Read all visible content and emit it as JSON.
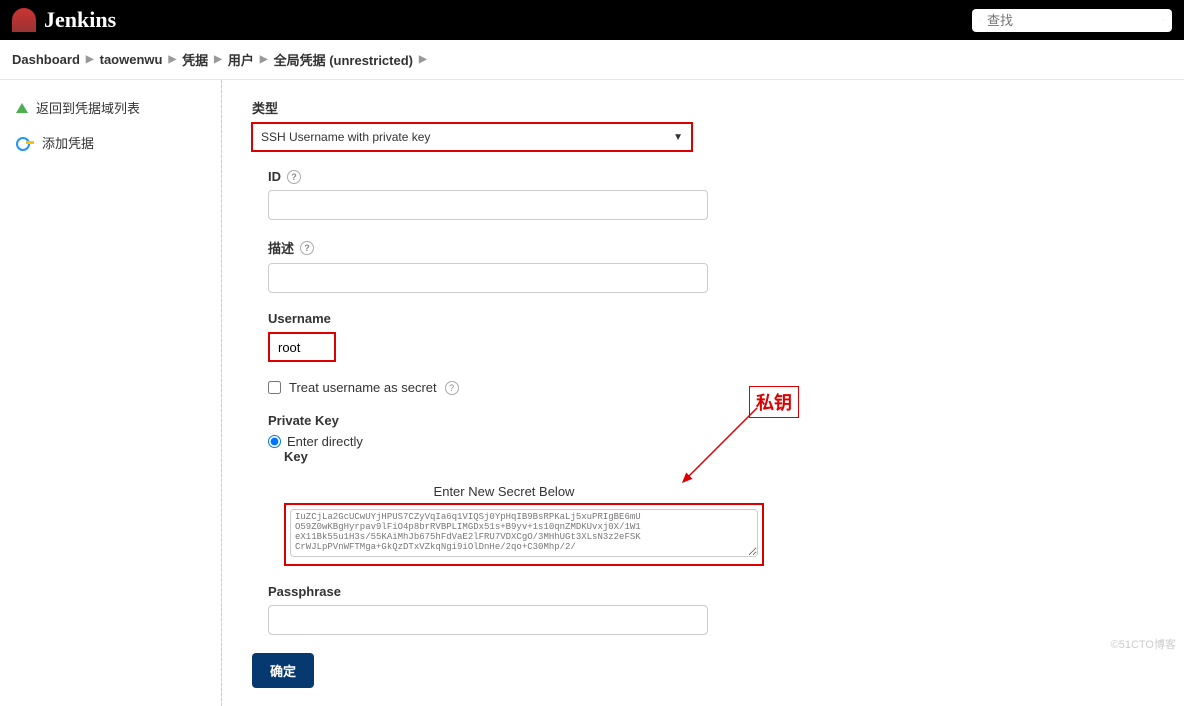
{
  "header": {
    "brand": "Jenkins",
    "search_placeholder": "查找"
  },
  "breadcrumbs": [
    "Dashboard",
    "taowenwu",
    "凭据",
    "用户",
    "全局凭据 (unrestricted)"
  ],
  "sidebar": {
    "items": [
      {
        "key": "back",
        "label": "返回到凭据域列表"
      },
      {
        "key": "add",
        "label": "添加凭据"
      }
    ]
  },
  "form": {
    "type_label": "类型",
    "type_value": "SSH Username with private key",
    "id_label": "ID",
    "id_value": "",
    "desc_label": "描述",
    "desc_value": "",
    "username_label": "Username",
    "username_value": "root",
    "treat_secret_label": "Treat username as secret",
    "treat_secret_checked": false,
    "private_key_label": "Private Key",
    "enter_directly_label": "Enter directly",
    "enter_directly_checked": true,
    "key_label": "Key",
    "secret_header": "Enter New Secret Below",
    "secret_value": "IuZCjLa2GcUCwUYjHPUS7CZyVqIa6q1VIQSj0YpHqIB9BsRPKaLj5xuPRIgBE6mU\nO59Z0wKBgHyrpav9lFiO4p8brRVBPLIMGDx51s+B9yv+1s10qnZMDKUvxj0X/1W1\neX11Bk55u1H3s/55KAiMhJb675hFdVaE2lFRU7VDXCgO/3MHhUGt3XLsN3z2eFSK\nCrWJLpPVnWFTMga+GkQzDTxVZkqNgi9iOlDnHe/2qo+C30Mhp/2/",
    "passphrase_label": "Passphrase",
    "passphrase_value": "",
    "submit_label": "确定"
  },
  "annotation": {
    "label": "私钥"
  },
  "watermark": "©51CTO博客"
}
